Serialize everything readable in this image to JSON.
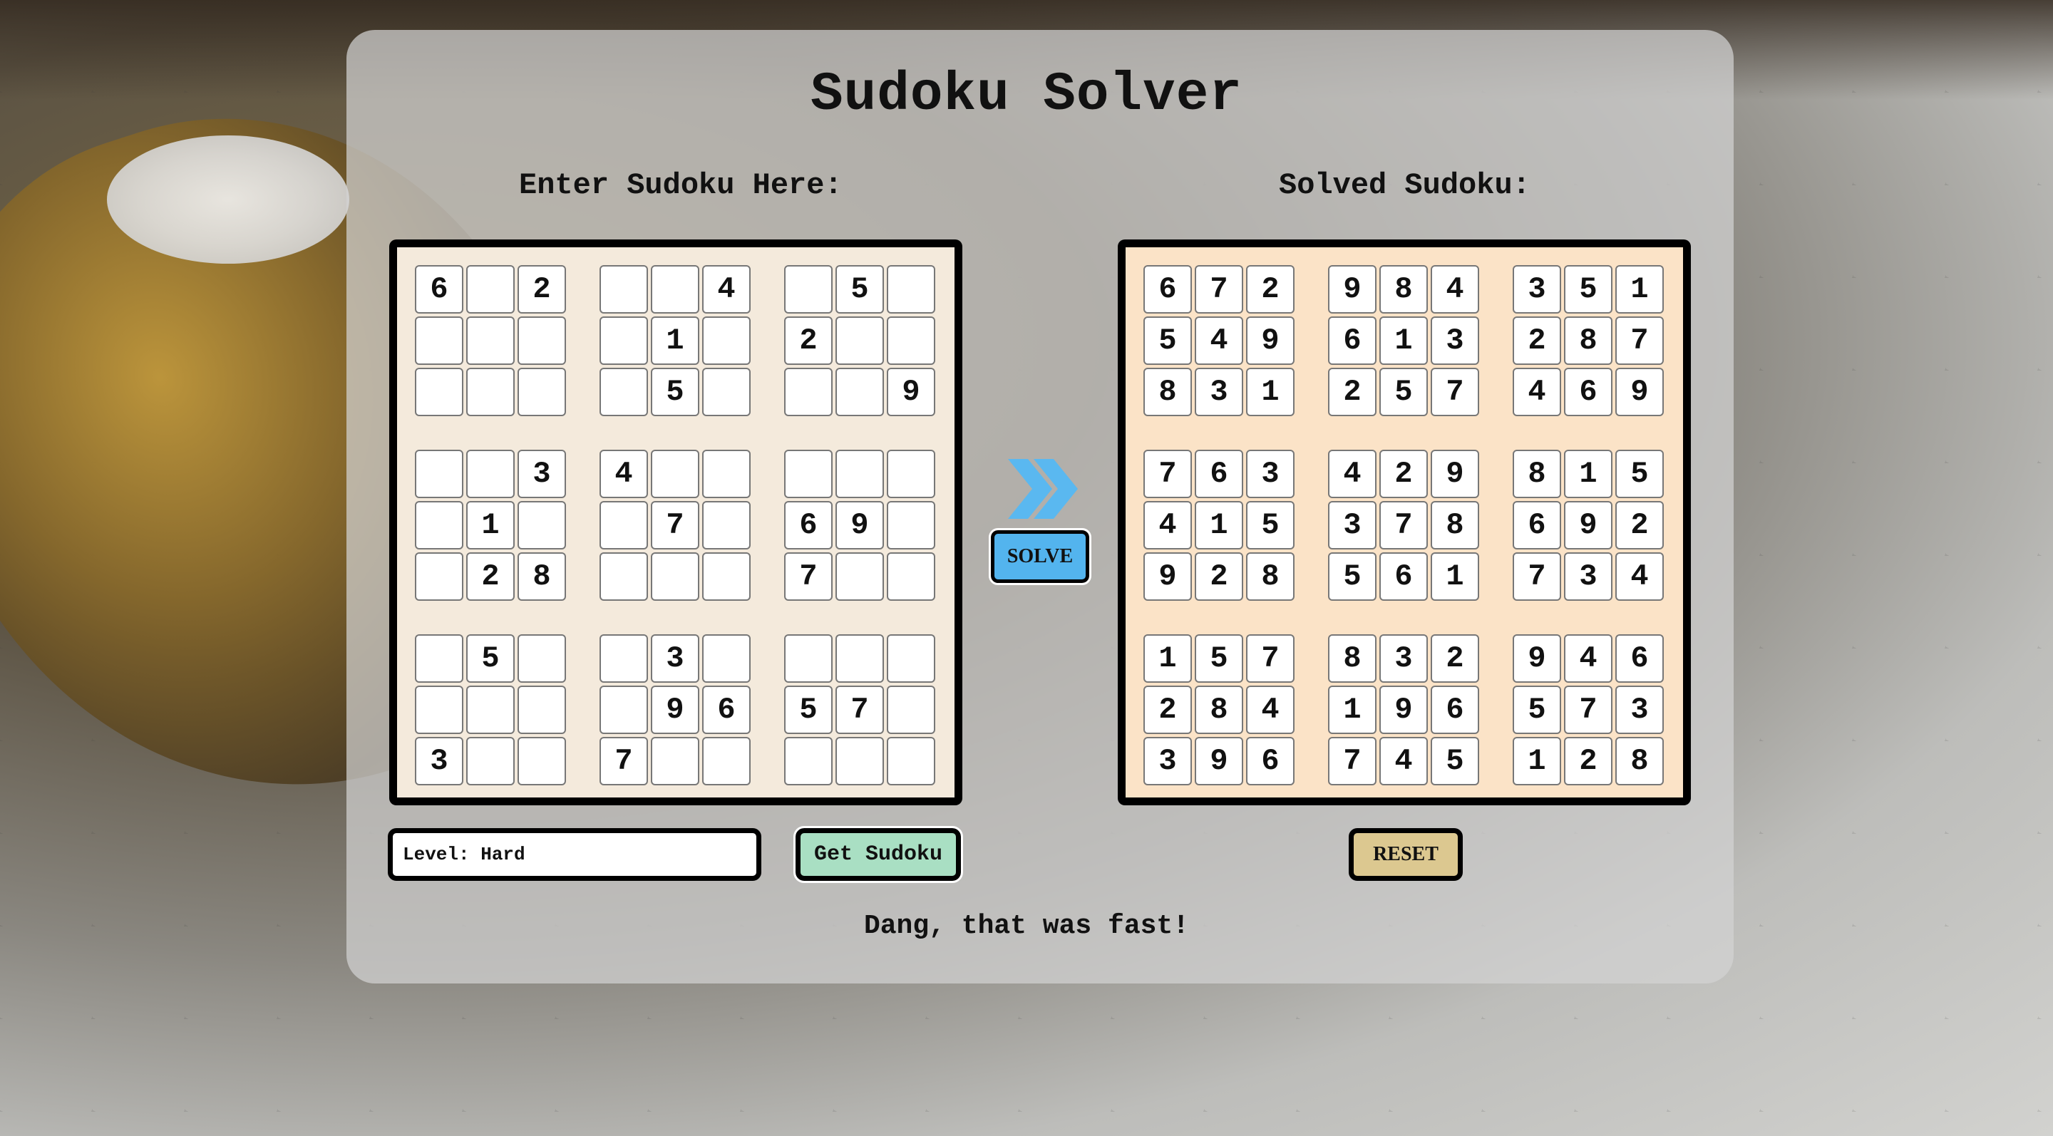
{
  "page": {
    "title": "Sudoku Solver",
    "input_heading": "Enter Sudoku Here:",
    "output_heading": "Solved Sudoku:",
    "status_message": "Dang, that was fast!"
  },
  "controls": {
    "solve_label": "SOLVE",
    "solve_icon": "double-chevron-right-icon",
    "level_value": "Level: Hard",
    "get_sudoku_label": "Get Sudoku",
    "reset_label": "RESET"
  },
  "colors": {
    "solve_button": "#53b4ee",
    "arrow": "#5ab8f0",
    "get_button": "#a9dfc3",
    "reset_button": "#dcc890",
    "input_board": "#f4eadc",
    "output_board": "#fbe3c7"
  },
  "input_grid": [
    [
      "6",
      "",
      "2",
      "",
      "",
      "4",
      "",
      "5",
      ""
    ],
    [
      "",
      "",
      "",
      "",
      "1",
      "",
      "2",
      "",
      ""
    ],
    [
      "",
      "",
      "",
      "",
      "5",
      "",
      "",
      "",
      "9"
    ],
    [
      "",
      "",
      "3",
      "4",
      "",
      "",
      "",
      "",
      ""
    ],
    [
      "",
      "1",
      "",
      "",
      "7",
      "",
      "6",
      "9",
      ""
    ],
    [
      "",
      "2",
      "8",
      "",
      "",
      "",
      "7",
      "",
      ""
    ],
    [
      "",
      "5",
      "",
      "",
      "3",
      "",
      "",
      "",
      ""
    ],
    [
      "",
      "",
      "",
      "",
      "9",
      "6",
      "5",
      "7",
      ""
    ],
    [
      "3",
      "",
      "",
      "7",
      "",
      "",
      "",
      "",
      ""
    ]
  ],
  "solved_grid": [
    [
      "6",
      "7",
      "2",
      "9",
      "8",
      "4",
      "3",
      "5",
      "1"
    ],
    [
      "5",
      "4",
      "9",
      "6",
      "1",
      "3",
      "2",
      "8",
      "7"
    ],
    [
      "8",
      "3",
      "1",
      "2",
      "5",
      "7",
      "4",
      "6",
      "9"
    ],
    [
      "7",
      "6",
      "3",
      "4",
      "2",
      "9",
      "8",
      "1",
      "5"
    ],
    [
      "4",
      "1",
      "5",
      "3",
      "7",
      "8",
      "6",
      "9",
      "2"
    ],
    [
      "9",
      "2",
      "8",
      "5",
      "6",
      "1",
      "7",
      "3",
      "4"
    ],
    [
      "1",
      "5",
      "7",
      "8",
      "3",
      "2",
      "9",
      "4",
      "6"
    ],
    [
      "2",
      "8",
      "4",
      "1",
      "9",
      "6",
      "5",
      "7",
      "3"
    ],
    [
      "3",
      "9",
      "6",
      "7",
      "4",
      "5",
      "1",
      "2",
      "8"
    ]
  ]
}
